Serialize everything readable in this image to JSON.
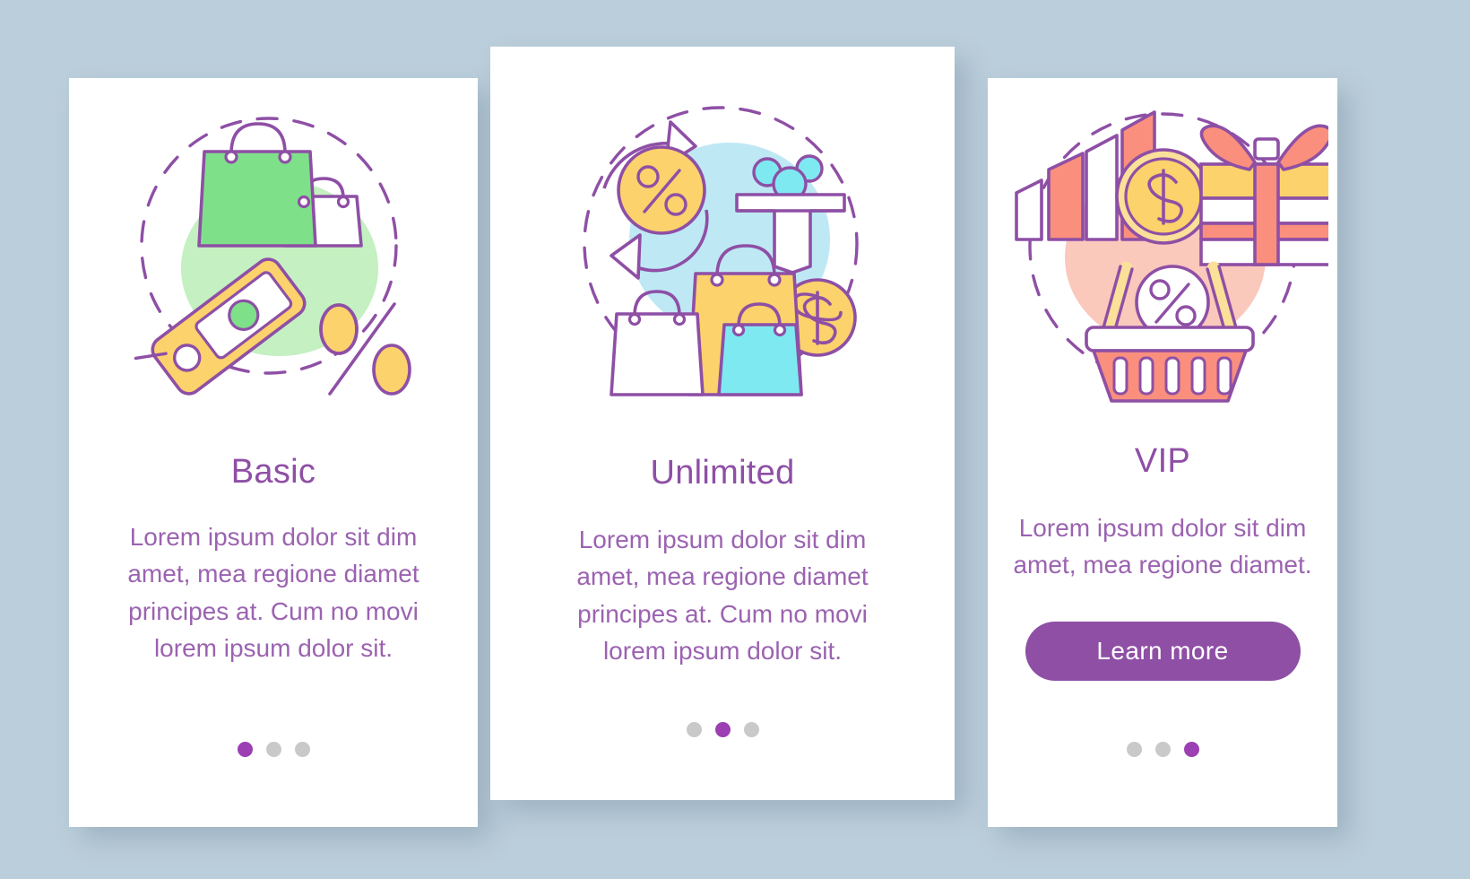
{
  "page": {
    "background_color": "#bbcedb",
    "accent_color": "#8e4fa5",
    "text_color": "#9b63b0",
    "dot_active_color": "#9b3fb3",
    "dot_inactive_color": "#c9c9c9"
  },
  "cards": [
    {
      "title": "Basic",
      "description": "Lorem ipsum dolor sit dim amet, mea regione diamet principes at. Cum no movi lorem ipsum dolor sit.",
      "illustration": "shopping-bags-price-tag-percent-illustration",
      "dots": {
        "count": 3,
        "active_index": 0
      }
    },
    {
      "title": "Unlimited",
      "description": "Lorem ipsum dolor sit dim amet, mea regione diamet principes at. Cum no movi lorem ipsum dolor sit.",
      "illustration": "percent-refresh-funnel-bags-dollar-coin-illustration",
      "dots": {
        "count": 3,
        "active_index": 1
      }
    },
    {
      "title": "VIP",
      "description": "Lorem ipsum dolor sit dim amet, mea regione diamet.",
      "illustration": "megaphone-dollar-coin-gift-box-basket-percent-illustration",
      "button": {
        "label": "Learn more"
      },
      "dots": {
        "count": 3,
        "active_index": 2
      }
    }
  ],
  "palette": {
    "outline": "#8e4fa5",
    "green": "#7fe08a",
    "green_blob": "#c4f0c2",
    "yellow": "#fbd26b",
    "blue_blob": "#bfe8f5",
    "cyan": "#7fe9f2",
    "cyan_light": "#9fe9f7",
    "coral": "#fa8f7d",
    "pink_blob": "#fbc8bc",
    "yellow_soft": "#fae099"
  }
}
